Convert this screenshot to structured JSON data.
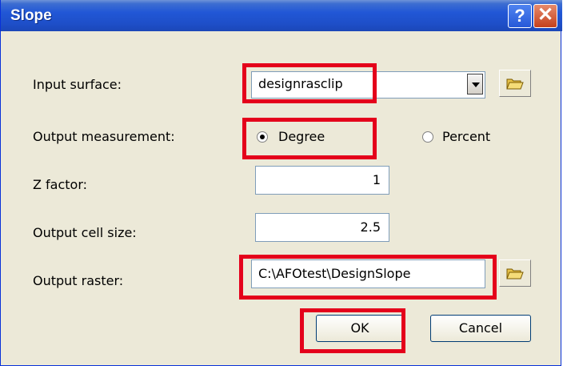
{
  "dialog": {
    "title": "Slope",
    "help_label": "?",
    "close_label": "✕"
  },
  "form": {
    "input_surface": {
      "label": "Input surface:",
      "value": "designrasclip"
    },
    "output_measurement": {
      "label": "Output measurement:",
      "options": [
        {
          "label": "Degree",
          "checked": true
        },
        {
          "label": "Percent",
          "checked": false
        }
      ]
    },
    "z_factor": {
      "label": "Z factor:",
      "value": "1"
    },
    "output_cell_size": {
      "label": "Output cell size:",
      "value": "2.5"
    },
    "output_raster": {
      "label": "Output raster:",
      "value": "C:\\AFOtest\\DesignSlope"
    }
  },
  "buttons": {
    "ok": "OK",
    "cancel": "Cancel"
  },
  "icons": {
    "browse": "open-folder-icon",
    "dropdown": "chevron-down-icon"
  },
  "colors": {
    "highlight": "#e4001b",
    "title_bar": "#2157d6",
    "dialog_bg": "#ece9d8"
  }
}
